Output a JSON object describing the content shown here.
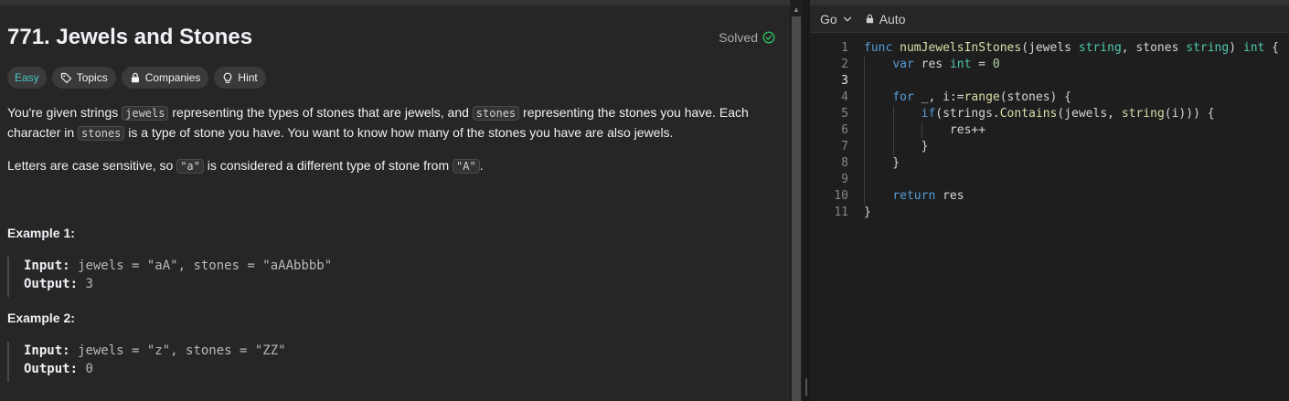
{
  "problem": {
    "title": "771. Jewels and Stones",
    "status": "Solved",
    "difficulty": "Easy",
    "tags": [
      "Topics",
      "Companies",
      "Hint"
    ],
    "para1": {
      "a": "You're given strings ",
      "code1": "jewels",
      "b": " representing the types of stones that are jewels, and ",
      "code2": "stones",
      "c": " representing the stones you have. Each character in ",
      "code3": "stones",
      "d": " is a type of stone you have. You want to know how many of the stones you have are also jewels."
    },
    "para2": {
      "a": "Letters are case sensitive, so ",
      "code1": "\"a\"",
      "b": " is considered a different type of stone from ",
      "code2": "\"A\"",
      "c": "."
    },
    "examples": [
      {
        "heading": "Example 1:",
        "input_label": "Input:",
        "input": "jewels = \"aA\", stones = \"aAAbbbb\"",
        "output_label": "Output:",
        "output": "3"
      },
      {
        "heading": "Example 2:",
        "input_label": "Input:",
        "input": "jewels = \"z\", stones = \"ZZ\"",
        "output_label": "Output:",
        "output": "0"
      }
    ]
  },
  "editor": {
    "language": "Go",
    "mode": "Auto",
    "line_numbers": [
      "1",
      "2",
      "3",
      "4",
      "5",
      "6",
      "7",
      "8",
      "9",
      "10",
      "11"
    ],
    "active_line": 3
  },
  "icons": {
    "solved": "check-circle-icon",
    "topics": "tag-icon",
    "companies": "lock-icon",
    "hint": "lightbulb-icon",
    "language": "chevron-down-icon",
    "mode": "lock-icon"
  },
  "colors": {
    "easy": "#46c6c2",
    "solved_check": "#2cbb5d",
    "keyword": "#569cd6",
    "function": "#dcdcaa",
    "type": "#4ec9b0",
    "number": "#b5cea8"
  }
}
